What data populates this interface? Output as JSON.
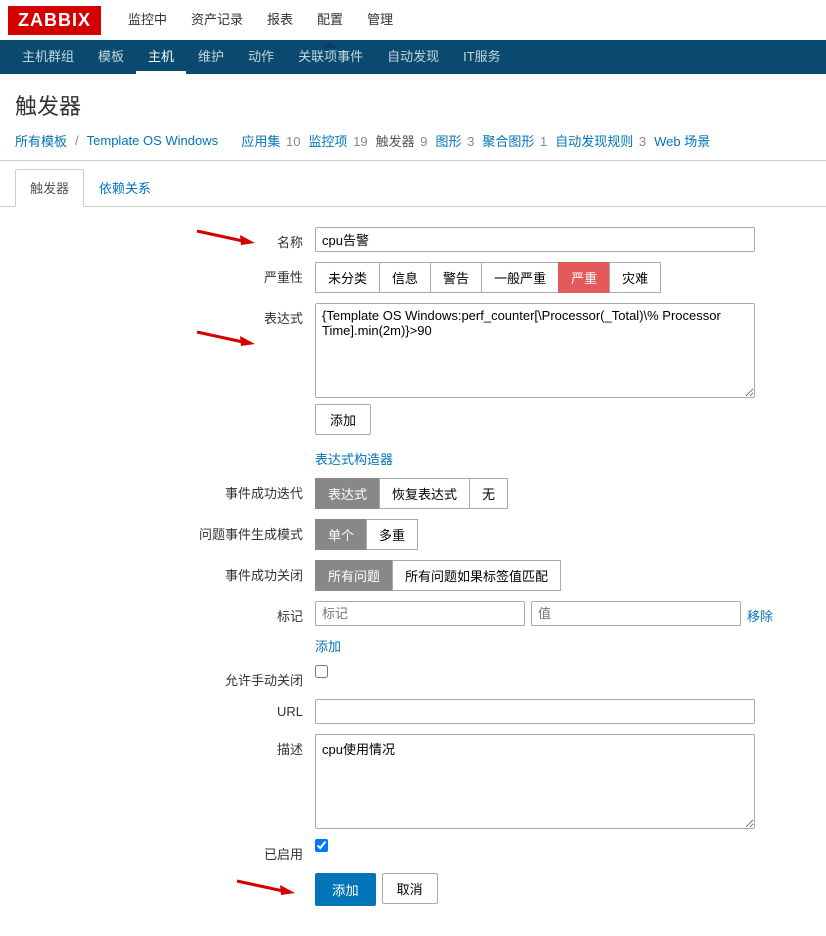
{
  "logo": "ZABBIX",
  "topnav": {
    "items": [
      "监控中",
      "资产记录",
      "报表",
      "配置",
      "管理"
    ],
    "active_index": 3
  },
  "subnav": {
    "items": [
      "主机群组",
      "模板",
      "主机",
      "维护",
      "动作",
      "关联项事件",
      "自动发现",
      "IT服务"
    ],
    "active_index": 2
  },
  "page_title": "触发器",
  "breadcrumb": {
    "root": "所有模板",
    "template": "Template OS Windows",
    "items": [
      {
        "label": "应用集",
        "count": "10"
      },
      {
        "label": "监控项",
        "count": "19"
      },
      {
        "label": "触发器",
        "count": "9",
        "active": true
      },
      {
        "label": "图形",
        "count": "3"
      },
      {
        "label": "聚合图形",
        "count": "1"
      },
      {
        "label": "自动发现规则",
        "count": "3"
      },
      {
        "label": "Web 场景",
        "count": ""
      }
    ]
  },
  "tabs": {
    "items": [
      "触发器",
      "依赖关系"
    ],
    "active_index": 0
  },
  "form": {
    "name_label": "名称",
    "name_value": "cpu告警",
    "severity_label": "严重性",
    "severity_options": [
      "未分类",
      "信息",
      "警告",
      "一般严重",
      "严重",
      "灾难"
    ],
    "severity_selected": 4,
    "expr_label": "表达式",
    "expr_value": "{Template OS Windows:perf_counter[\\Processor(_Total)\\% Processor Time].min(2m)}>90",
    "expr_add_btn": "添加",
    "expr_builder_link": "表达式构造器",
    "event_iter_label": "事件成功迭代",
    "event_iter_options": [
      "表达式",
      "恢复表达式",
      "无"
    ],
    "event_iter_selected": 0,
    "prob_gen_label": "问题事件生成模式",
    "prob_gen_options": [
      "单个",
      "多重"
    ],
    "prob_gen_selected": 0,
    "event_close_label": "事件成功关闭",
    "event_close_options": [
      "所有问题",
      "所有问题如果标签值匹配"
    ],
    "event_close_selected": 0,
    "tags_label": "标记",
    "tag_name_placeholder": "标记",
    "tag_value_placeholder": "值",
    "tag_remove_link": "移除",
    "tag_add_link": "添加",
    "manual_close_label": "允许手动关闭",
    "url_label": "URL",
    "url_value": "",
    "desc_label": "描述",
    "desc_value": "cpu使用情况",
    "enabled_label": "已启用",
    "submit_btn": "添加",
    "cancel_btn": "取消"
  }
}
